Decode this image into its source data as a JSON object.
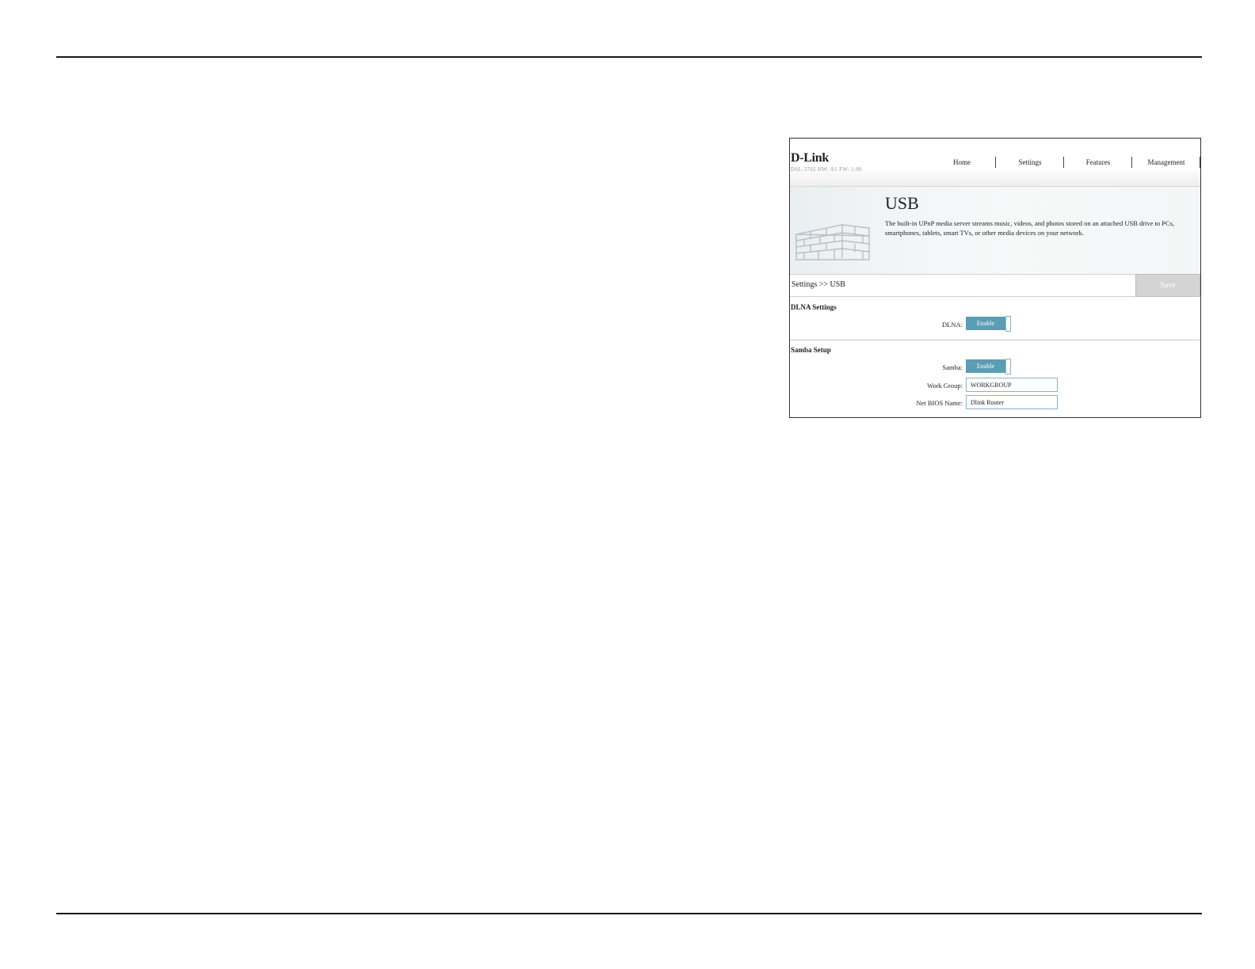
{
  "router": {
    "logo": "D-Link",
    "model_info": "DSL-3782  HW: A1  FW: 1.00",
    "nav": [
      {
        "label": "Home"
      },
      {
        "label": "Settings"
      },
      {
        "label": "Features"
      },
      {
        "label": "Management"
      }
    ],
    "banner": {
      "title": "USB",
      "description": "The built-in UPnP media server streams music, videos, and photos stored on an attached USB drive to PCs, smartphones, tablets, smart TVs, or other media devices on your network."
    },
    "breadcrumb": "Settings >> USB",
    "save_label": "Save",
    "dlna": {
      "section_title": "DLNA Settings",
      "label": "DLNA:",
      "toggle_label": "Enable"
    },
    "samba": {
      "section_title": "Samba Setup",
      "label": "Samba:",
      "toggle_label": "Enable",
      "work_group_label": "Work Group:",
      "work_group_value": "WORKGROUP",
      "netbios_label": "Net BIOS Name:",
      "netbios_value": "Dlink Router"
    }
  },
  "colors": {
    "accent": "#5b9db5",
    "save_disabled": "#d4d4d4"
  }
}
